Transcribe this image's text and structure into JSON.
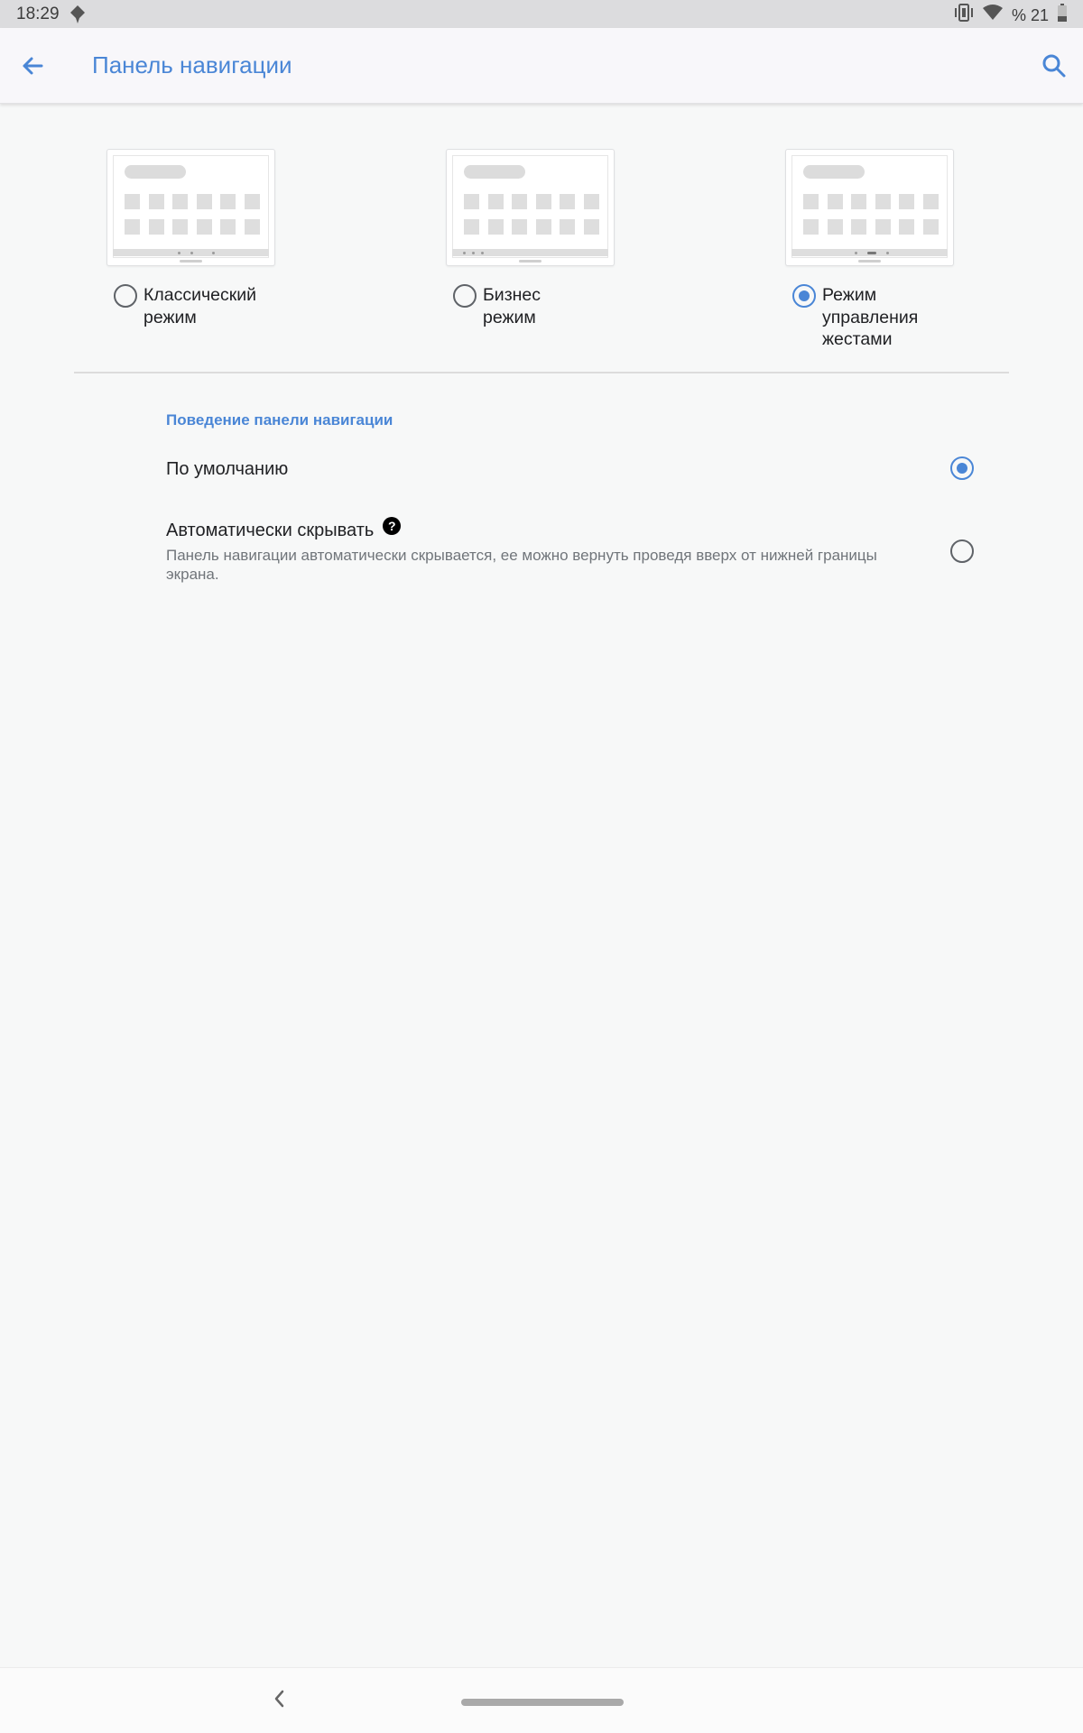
{
  "status_bar": {
    "time": "18:29",
    "battery_text": "% 21",
    "icons": [
      "notification-icon",
      "vibrate-icon",
      "wifi-icon",
      "battery-icon"
    ]
  },
  "app_bar": {
    "title": "Панель навигации",
    "back_icon": "arrow-back-icon",
    "search_icon": "search-icon"
  },
  "modes": [
    {
      "label": "Классический\nрежим",
      "selected": false
    },
    {
      "label": "Бизнес\nрежим",
      "selected": false
    },
    {
      "label": "Режим\nуправления\nжестами",
      "selected": true
    }
  ],
  "behavior": {
    "section_title": "Поведение панели навигации",
    "default_option": {
      "title": "По умолчанию",
      "selected": true
    },
    "auto_hide_option": {
      "title": "Автоматически скрывать",
      "help_icon": "?",
      "subtitle": "Панель навигации автоматически скрывается, ее можно вернуть проведя вверх от нижней границы экрана.",
      "selected": false
    }
  },
  "colors": {
    "accent": "#4a86d6",
    "background": "#f7f8f8"
  }
}
